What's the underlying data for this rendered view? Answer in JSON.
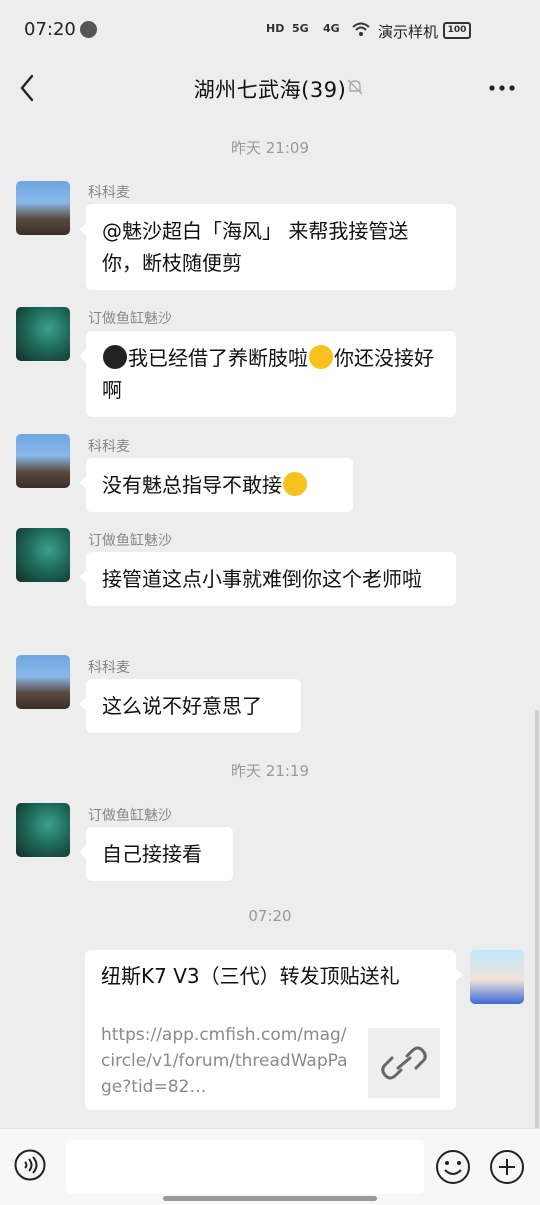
{
  "status_bar": {
    "time": "07:20",
    "hd_label": "HD",
    "net1": "5G",
    "net2": "4G",
    "carrier": "演示样机",
    "battery": "100"
  },
  "header": {
    "title": "湖州七武海(39)"
  },
  "timestamps": [
    "昨天 21:09",
    "昨天 21:19",
    "07:20"
  ],
  "messages": [
    {
      "sender": "科科麦",
      "text": "@魅沙超白「海风」 来帮我接管送你，断枝随便剪"
    },
    {
      "sender": "订做鱼缸魅沙",
      "text_before": "",
      "text_mid": "我已经借了养断肢啦",
      "text_after": "你还没接好啊"
    },
    {
      "sender": "科科麦",
      "text": "没有魅总指导不敢接"
    },
    {
      "sender": "订做鱼缸魅沙",
      "text": "接管道这点小事就难倒你这个老师啦"
    },
    {
      "sender": "科科麦",
      "text": "这么说不好意思了"
    },
    {
      "sender": "订做鱼缸魅沙",
      "text": "自己接接看"
    }
  ],
  "link_card": {
    "title": "纽斯K7 V3（三代）转发顶贴送礼",
    "url": "https://app.cmfish.com/mag/circle/v1/forum/threadWapPage?tid=82…"
  },
  "icons": [
    "back-icon",
    "mute-bell-icon",
    "more-icon",
    "voice-icon",
    "emoji-icon",
    "plus-icon",
    "link-icon"
  ]
}
